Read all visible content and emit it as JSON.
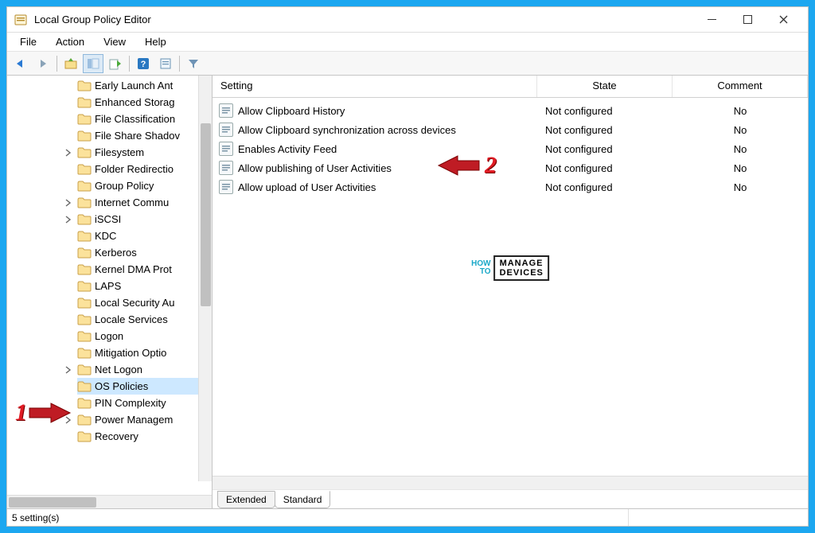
{
  "window": {
    "title": "Local Group Policy Editor"
  },
  "menu": {
    "file": "File",
    "action": "Action",
    "view": "View",
    "help": "Help"
  },
  "tree": {
    "items": [
      {
        "label": "Early Launch Ant",
        "expandable": false
      },
      {
        "label": "Enhanced Storag",
        "expandable": false
      },
      {
        "label": "File Classification",
        "expandable": false
      },
      {
        "label": "File Share Shadov",
        "expandable": false
      },
      {
        "label": "Filesystem",
        "expandable": true
      },
      {
        "label": "Folder Redirectio",
        "expandable": false
      },
      {
        "label": "Group Policy",
        "expandable": false
      },
      {
        "label": "Internet Commu",
        "expandable": true
      },
      {
        "label": "iSCSI",
        "expandable": true
      },
      {
        "label": "KDC",
        "expandable": false
      },
      {
        "label": "Kerberos",
        "expandable": false
      },
      {
        "label": "Kernel DMA Prot",
        "expandable": false
      },
      {
        "label": "LAPS",
        "expandable": false
      },
      {
        "label": "Local Security Au",
        "expandable": false
      },
      {
        "label": "Locale Services",
        "expandable": false
      },
      {
        "label": "Logon",
        "expandable": false
      },
      {
        "label": "Mitigation Optio",
        "expandable": false
      },
      {
        "label": "Net Logon",
        "expandable": true
      },
      {
        "label": "OS Policies",
        "expandable": false,
        "selected": true
      },
      {
        "label": "PIN Complexity",
        "expandable": false
      },
      {
        "label": "Power Managem",
        "expandable": true
      },
      {
        "label": "Recovery",
        "expandable": false
      }
    ]
  },
  "list": {
    "headers": {
      "setting": "Setting",
      "state": "State",
      "comment": "Comment"
    },
    "rows": [
      {
        "setting": "Allow Clipboard History",
        "state": "Not configured",
        "comment": "No"
      },
      {
        "setting": "Allow Clipboard synchronization across devices",
        "state": "Not configured",
        "comment": "No"
      },
      {
        "setting": "Enables Activity Feed",
        "state": "Not configured",
        "comment": "No"
      },
      {
        "setting": "Allow publishing of User Activities",
        "state": "Not configured",
        "comment": "No"
      },
      {
        "setting": "Allow upload of User Activities",
        "state": "Not configured",
        "comment": "No"
      }
    ]
  },
  "tabs": {
    "extended": "Extended",
    "standard": "Standard"
  },
  "status": {
    "text": "5 setting(s)"
  },
  "annotations": {
    "num1": "1",
    "num2": "2"
  },
  "watermark": {
    "how": "HOW",
    "to": "TO",
    "manage": "MANAGE",
    "devices": "DEVICES"
  }
}
